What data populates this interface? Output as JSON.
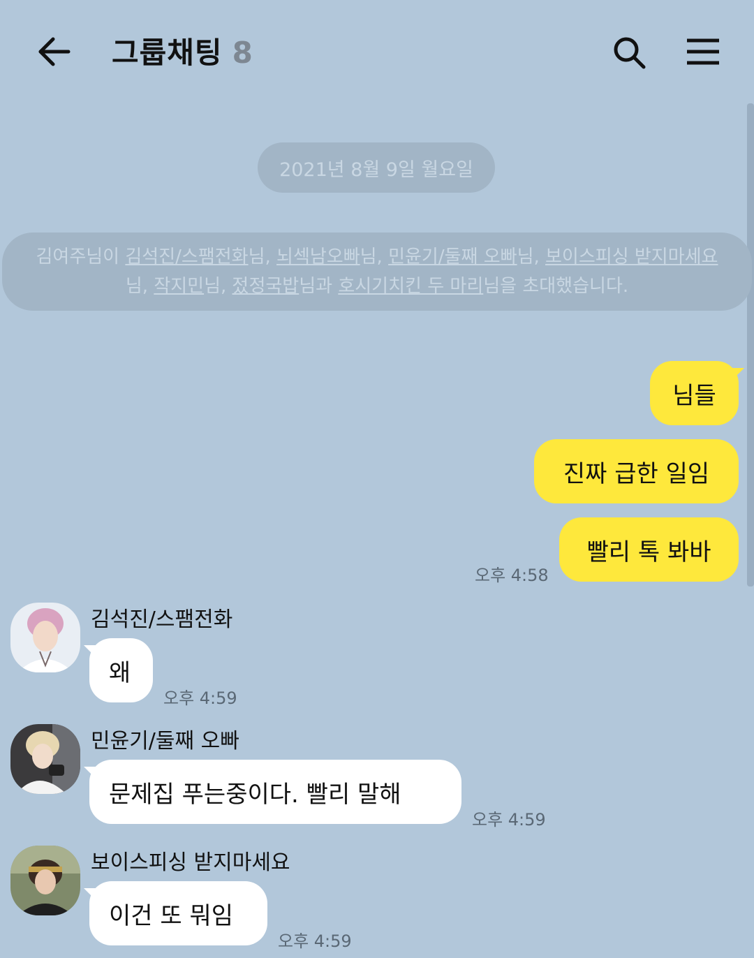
{
  "header": {
    "title": "그룹채팅",
    "member_count": "8",
    "back_icon": "arrow-left-icon",
    "search_icon": "search-icon",
    "menu_icon": "hamburger-menu-icon"
  },
  "date_divider": "2021년 8월 9일 월요일",
  "system_notice": {
    "inviter": "김여주님이",
    "invitees": [
      "김석진/스팸전화",
      "뇌섹남오빠",
      "민윤기/둘째 오빠",
      "보이스피싱 받지마세요",
      "작지민",
      "젔정국밥",
      "호시기치킨 두 마리"
    ],
    "suffix": "님을 초대했습니다."
  },
  "messages_mine": [
    {
      "text": "님들"
    },
    {
      "text": "진짜 급한 일임"
    },
    {
      "text": "빨리 톡 봐바",
      "time": "오후 4:58"
    }
  ],
  "messages_others": [
    {
      "sender": "김석진/스팸전화",
      "text": "왜",
      "time": "오후 4:59"
    },
    {
      "sender": "민윤기/둘째 오빠",
      "text": "문제집 푸는중이다. 빨리 말해",
      "time": "오후 4:59"
    },
    {
      "sender": "보이스피싱 받지마세요",
      "text": "이건 또 뭐임",
      "time": "오후 4:59"
    }
  ],
  "colors": {
    "background": "#b2c7da",
    "my_bubble": "#fee83c",
    "their_bubble": "#ffffff",
    "system_pill": "#a2b5c6"
  }
}
